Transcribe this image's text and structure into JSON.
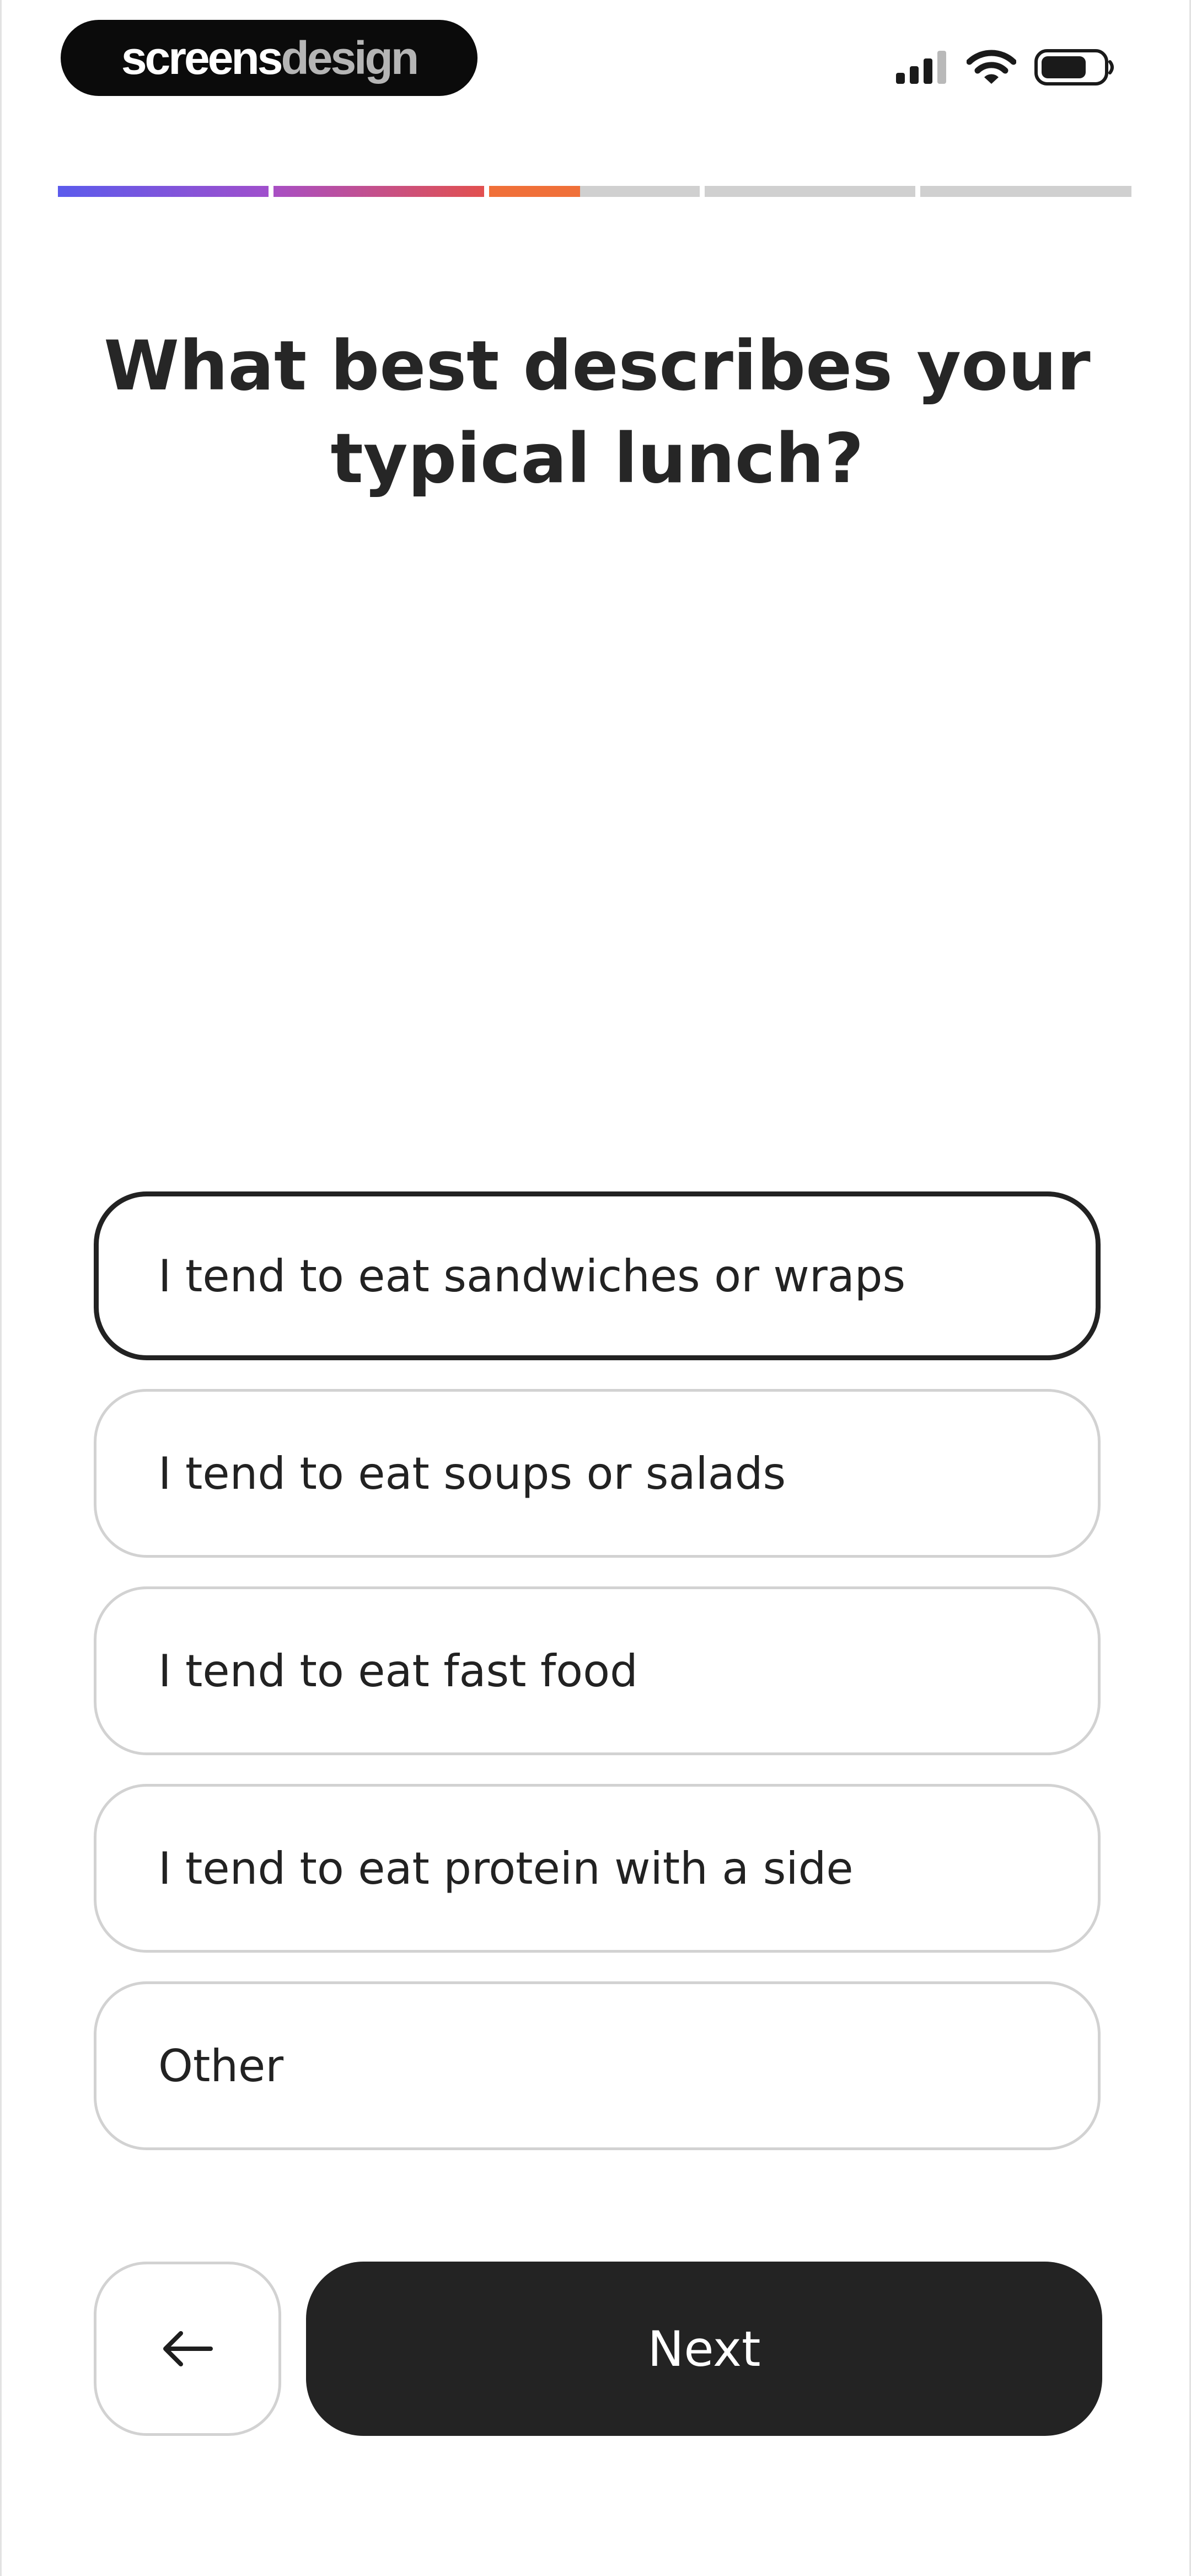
{
  "status_bar": {
    "brand_part1": "screens",
    "brand_part2": "design",
    "icons": [
      "cellular-signal-icon",
      "wifi-icon",
      "battery-icon"
    ]
  },
  "progress": {
    "segments_total": 6,
    "completed_fraction": 0.37,
    "gradient_colors": [
      "#5b5bec",
      "#a84fc4",
      "#e2504f",
      "#f07039"
    ],
    "track_color": "#d0d0d0"
  },
  "question": {
    "line1": "What best describes your",
    "line2": "typical lunch?"
  },
  "options": [
    {
      "label": "I tend to eat sandwiches or wraps",
      "selected": true
    },
    {
      "label": "I tend to eat soups or salads",
      "selected": false
    },
    {
      "label": "I tend to eat fast food",
      "selected": false
    },
    {
      "label": "I tend to eat protein with a side",
      "selected": false
    },
    {
      "label": "Other",
      "selected": false
    }
  ],
  "nav": {
    "back_icon": "arrow-left-icon",
    "next_label": "Next"
  }
}
